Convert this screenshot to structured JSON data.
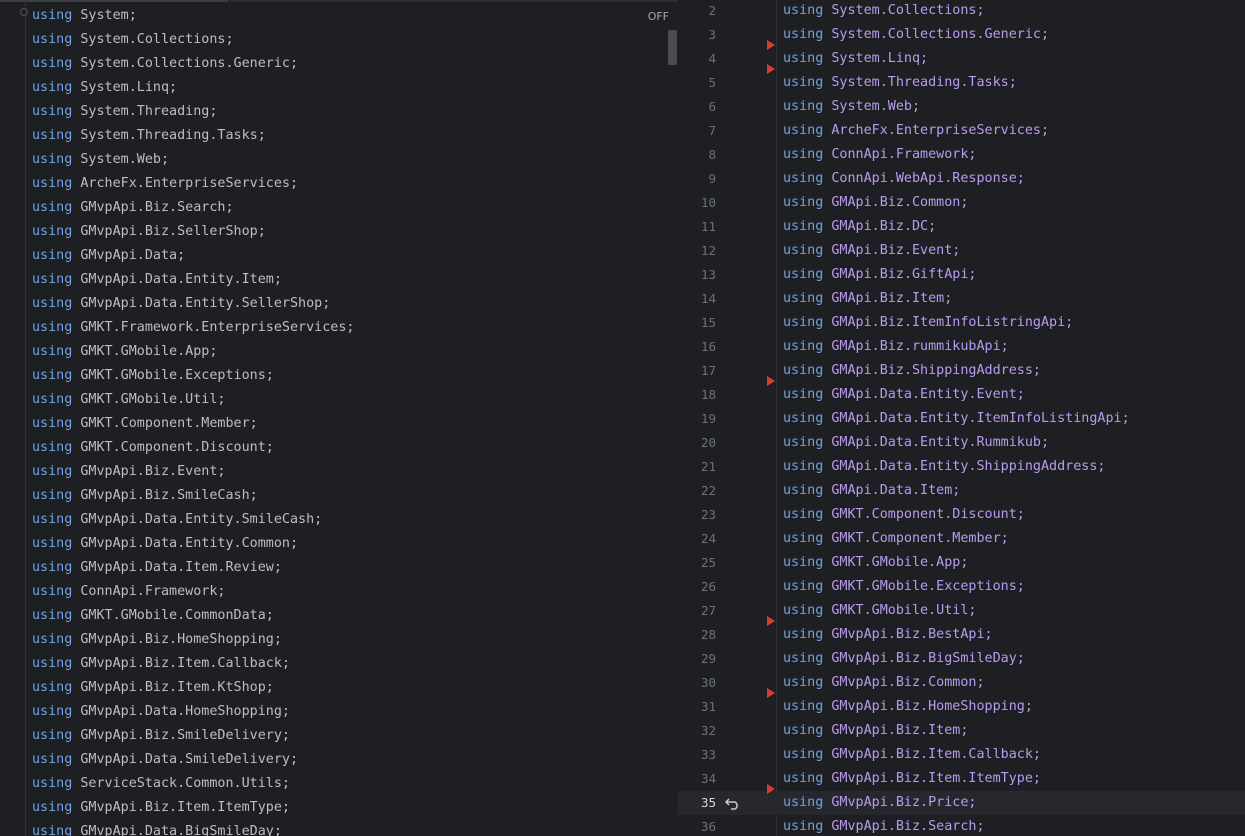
{
  "left_editor": {
    "off_label": "OFF",
    "keyword": "using",
    "lines": [
      "System;",
      "System.Collections;",
      "System.Collections.Generic;",
      "System.Linq;",
      "System.Threading;",
      "System.Threading.Tasks;",
      "System.Web;",
      "ArcheFx.EnterpriseServices;",
      "GMvpApi.Biz.Search;",
      "GMvpApi.Biz.SellerShop;",
      "GMvpApi.Data;",
      "GMvpApi.Data.Entity.Item;",
      "GMvpApi.Data.Entity.SellerShop;",
      "GMKT.Framework.EnterpriseServices;",
      "GMKT.GMobile.App;",
      "GMKT.GMobile.Exceptions;",
      "GMKT.GMobile.Util;",
      "GMKT.Component.Member;",
      "GMKT.Component.Discount;",
      "GMvpApi.Biz.Event;",
      "GMvpApi.Biz.SmileCash;",
      "GMvpApi.Data.Entity.SmileCash;",
      "GMvpApi.Data.Entity.Common;",
      "GMvpApi.Data.Item.Review;",
      "ConnApi.Framework;",
      "GMKT.GMobile.CommonData;",
      "GMvpApi.Biz.HomeShopping;",
      "GMvpApi.Biz.Item.Callback;",
      "GMvpApi.Biz.Item.KtShop;",
      "GMvpApi.Data.HomeShopping;",
      "GMvpApi.Biz.SmileDelivery;",
      "GMvpApi.Data.SmileDelivery;",
      "ServiceStack.Common.Utils;",
      "GMvpApi.Biz.Item.ItemType;",
      "GMvpApi.Data.BigSmileDay;"
    ]
  },
  "right_editor": {
    "keyword": "using",
    "current_line": "35",
    "lines": [
      {
        "num": "2",
        "ns": "System.Collections;"
      },
      {
        "num": "3",
        "ns": "System.Collections.Generic;"
      },
      {
        "num": "4",
        "ns": "System.Linq;"
      },
      {
        "num": "5",
        "ns": "System.Threading.Tasks;"
      },
      {
        "num": "6",
        "ns": "System.Web;"
      },
      {
        "num": "7",
        "ns": "ArcheFx.EnterpriseServices;"
      },
      {
        "num": "8",
        "ns": "ConnApi.Framework;"
      },
      {
        "num": "9",
        "ns": "ConnApi.WebApi.Response;"
      },
      {
        "num": "10",
        "ns": "GMApi.Biz.Common;"
      },
      {
        "num": "11",
        "ns": "GMApi.Biz.DC;"
      },
      {
        "num": "12",
        "ns": "GMApi.Biz.Event;"
      },
      {
        "num": "13",
        "ns": "GMApi.Biz.GiftApi;"
      },
      {
        "num": "14",
        "ns": "GMApi.Biz.Item;"
      },
      {
        "num": "15",
        "ns": "GMApi.Biz.ItemInfoListringApi;"
      },
      {
        "num": "16",
        "ns": "GMApi.Biz.rummikubApi;"
      },
      {
        "num": "17",
        "ns": "GMApi.Biz.ShippingAddress;"
      },
      {
        "num": "18",
        "ns": "GMApi.Data.Entity.Event;"
      },
      {
        "num": "19",
        "ns": "GMApi.Data.Entity.ItemInfoListingApi;"
      },
      {
        "num": "20",
        "ns": "GMApi.Data.Entity.Rummikub;"
      },
      {
        "num": "21",
        "ns": "GMApi.Data.Entity.ShippingAddress;"
      },
      {
        "num": "22",
        "ns": "GMApi.Data.Item;"
      },
      {
        "num": "23",
        "ns": "GMKT.Component.Discount;"
      },
      {
        "num": "24",
        "ns": "GMKT.Component.Member;"
      },
      {
        "num": "25",
        "ns": "GMKT.GMobile.App;"
      },
      {
        "num": "26",
        "ns": "GMKT.GMobile.Exceptions;"
      },
      {
        "num": "27",
        "ns": "GMKT.GMobile.Util;"
      },
      {
        "num": "28",
        "ns": "GMvpApi.Biz.BestApi;"
      },
      {
        "num": "29",
        "ns": "GMvpApi.Biz.BigSmileDay;"
      },
      {
        "num": "30",
        "ns": "GMvpApi.Biz.Common;"
      },
      {
        "num": "31",
        "ns": "GMvpApi.Biz.HomeShopping;"
      },
      {
        "num": "32",
        "ns": "GMvpApi.Biz.Item;"
      },
      {
        "num": "33",
        "ns": "GMvpApi.Biz.Item.Callback;"
      },
      {
        "num": "34",
        "ns": "GMvpApi.Biz.Item.ItemType;"
      },
      {
        "num": "35",
        "ns": "GMvpApi.Biz.Price;"
      },
      {
        "num": "36",
        "ns": "GMvpApi.Biz.Search;"
      }
    ],
    "change_markers_before_lines": [
      "4",
      "5",
      "18",
      "28",
      "31",
      "35"
    ]
  },
  "colors": {
    "background": "#1e1f22",
    "keyword": "#6fa2e0",
    "namespace_left": "#bcbec4",
    "namespace_right": "#b99bf0",
    "line_number": "#6e7178",
    "change_marker": "#d63a3a"
  },
  "icons": {
    "fold": "fold-icon",
    "revert": "revert-icon",
    "marker": "change-marker-icon"
  }
}
